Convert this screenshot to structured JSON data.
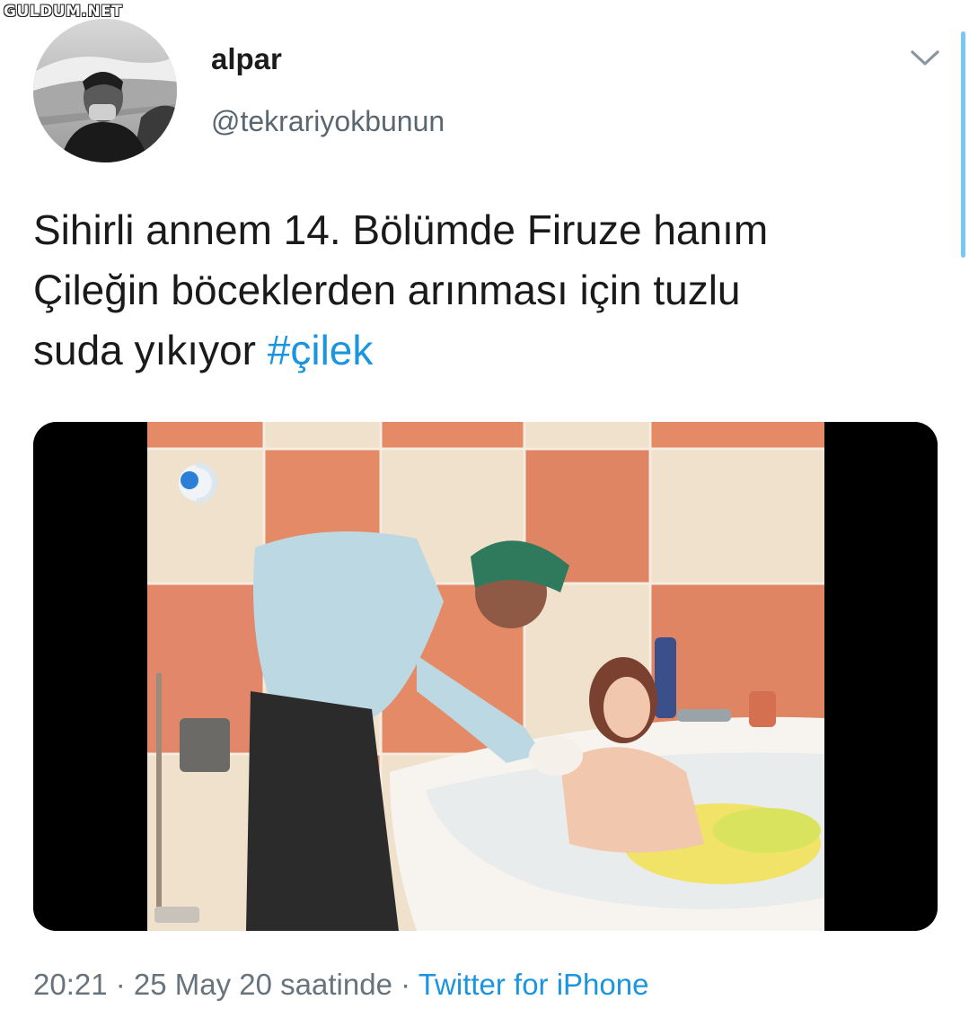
{
  "watermark": "GULDUM.NET",
  "tweet": {
    "display_name": "alpar",
    "handle": "@tekrariyokbunun",
    "text_lines": [
      "Sihirli annem 14. Bölümde Firuze hanım",
      "Çileğin böceklerden arınması için tuzlu",
      "suda yıkıyor "
    ],
    "hashtag": "#çilek",
    "time": "20:21",
    "separator": " · ",
    "date": "25 May 20 saatinde",
    "source": "Twitter for iPhone"
  },
  "icons": {
    "more": "chevron-down-icon",
    "channel_logo": "kanal-d-logo"
  },
  "colors": {
    "link": "#1b95e0",
    "secondary_text": "#67737d",
    "scrollbar": "#1da1f2"
  }
}
